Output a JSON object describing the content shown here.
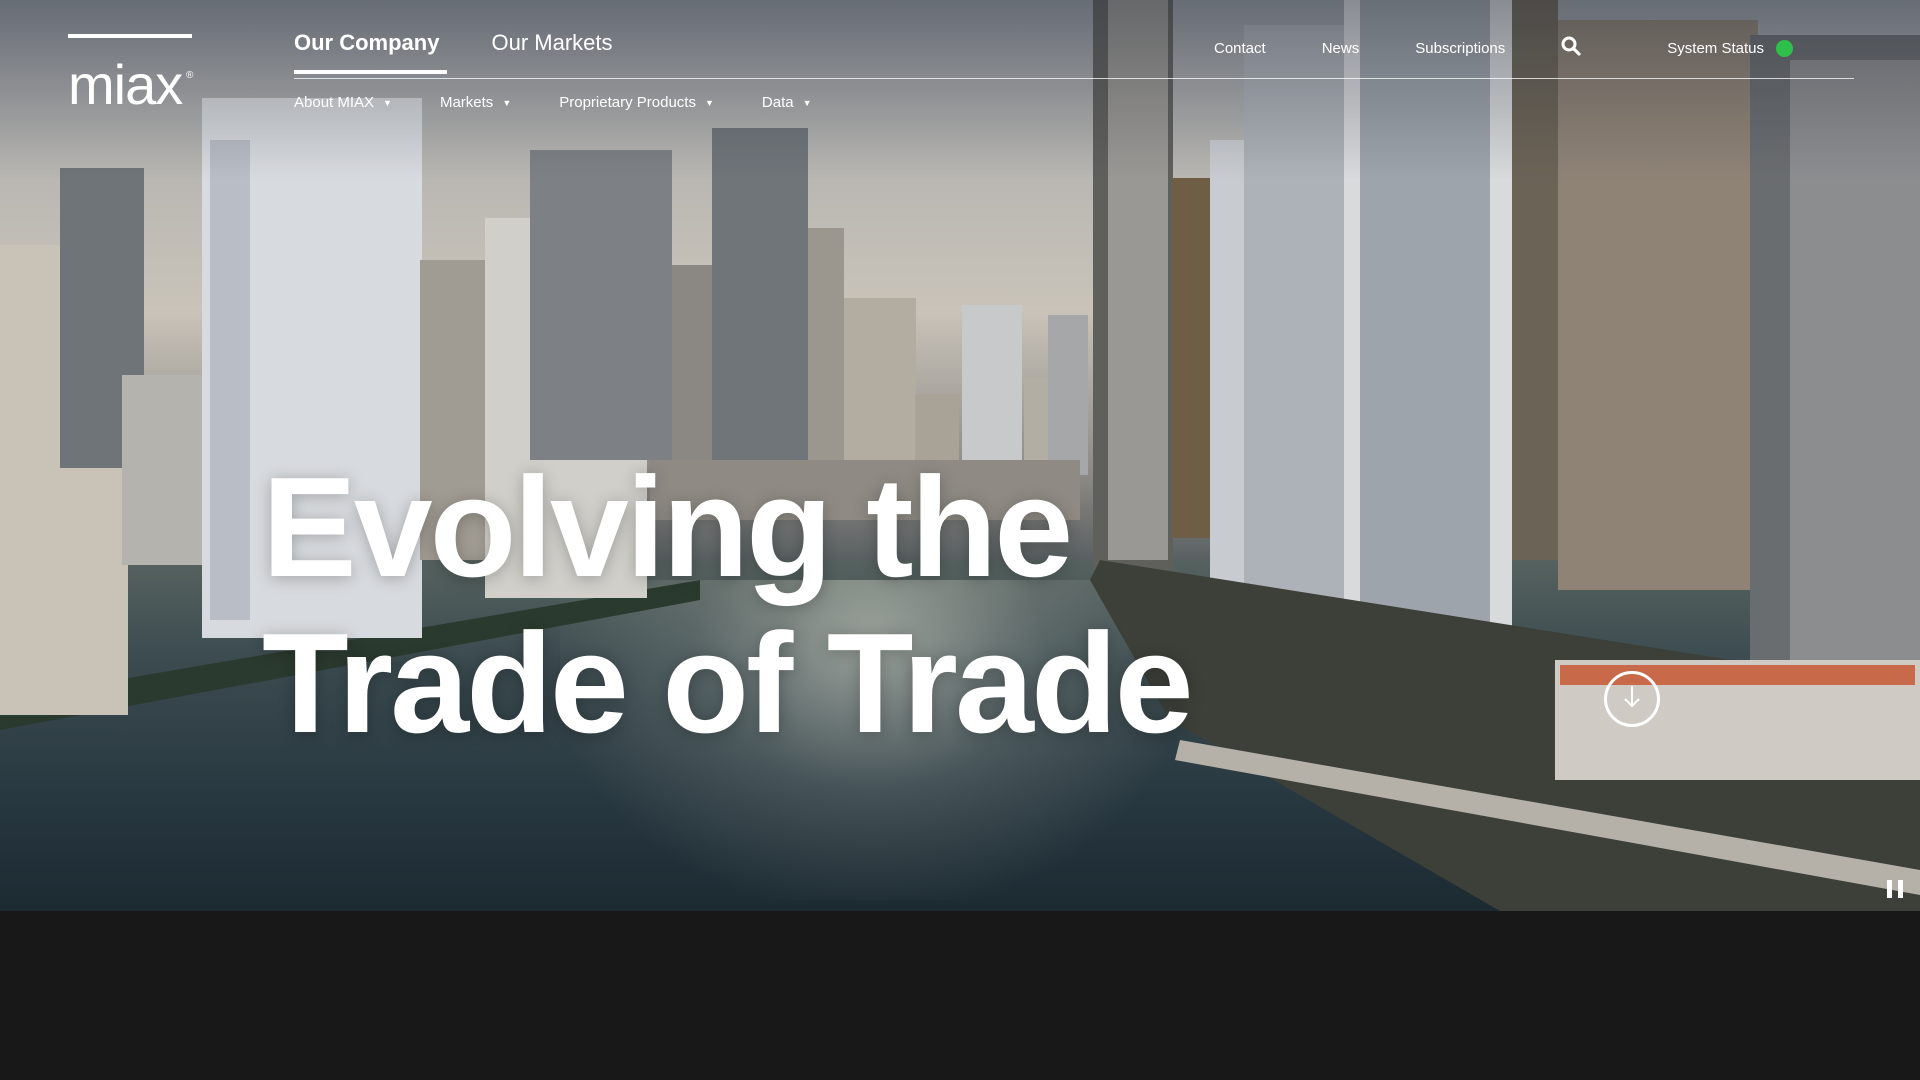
{
  "brand": {
    "name": "miax",
    "registered": "®"
  },
  "primary_nav": {
    "tabs": [
      {
        "label": "Our Company",
        "active": true
      },
      {
        "label": "Our Markets",
        "active": false
      }
    ]
  },
  "sub_nav": {
    "items": [
      {
        "label": "About MIAX",
        "has_dropdown": true
      },
      {
        "label": "Markets",
        "has_dropdown": true
      },
      {
        "label": "Proprietary Products",
        "has_dropdown": true
      },
      {
        "label": "Data",
        "has_dropdown": true
      }
    ],
    "caret_icon": "caret-down-icon"
  },
  "utility_nav": {
    "links": [
      "Contact",
      "News",
      "Subscriptions"
    ],
    "search_icon": "search-icon",
    "system_status": {
      "label": "System Status",
      "status_color": "#2ec04a"
    }
  },
  "hero": {
    "headline_line1": "Evolving the",
    "headline_line2": "Trade of Trade",
    "scroll_icon": "arrow-down-icon",
    "pause_icon": "pause-icon"
  }
}
